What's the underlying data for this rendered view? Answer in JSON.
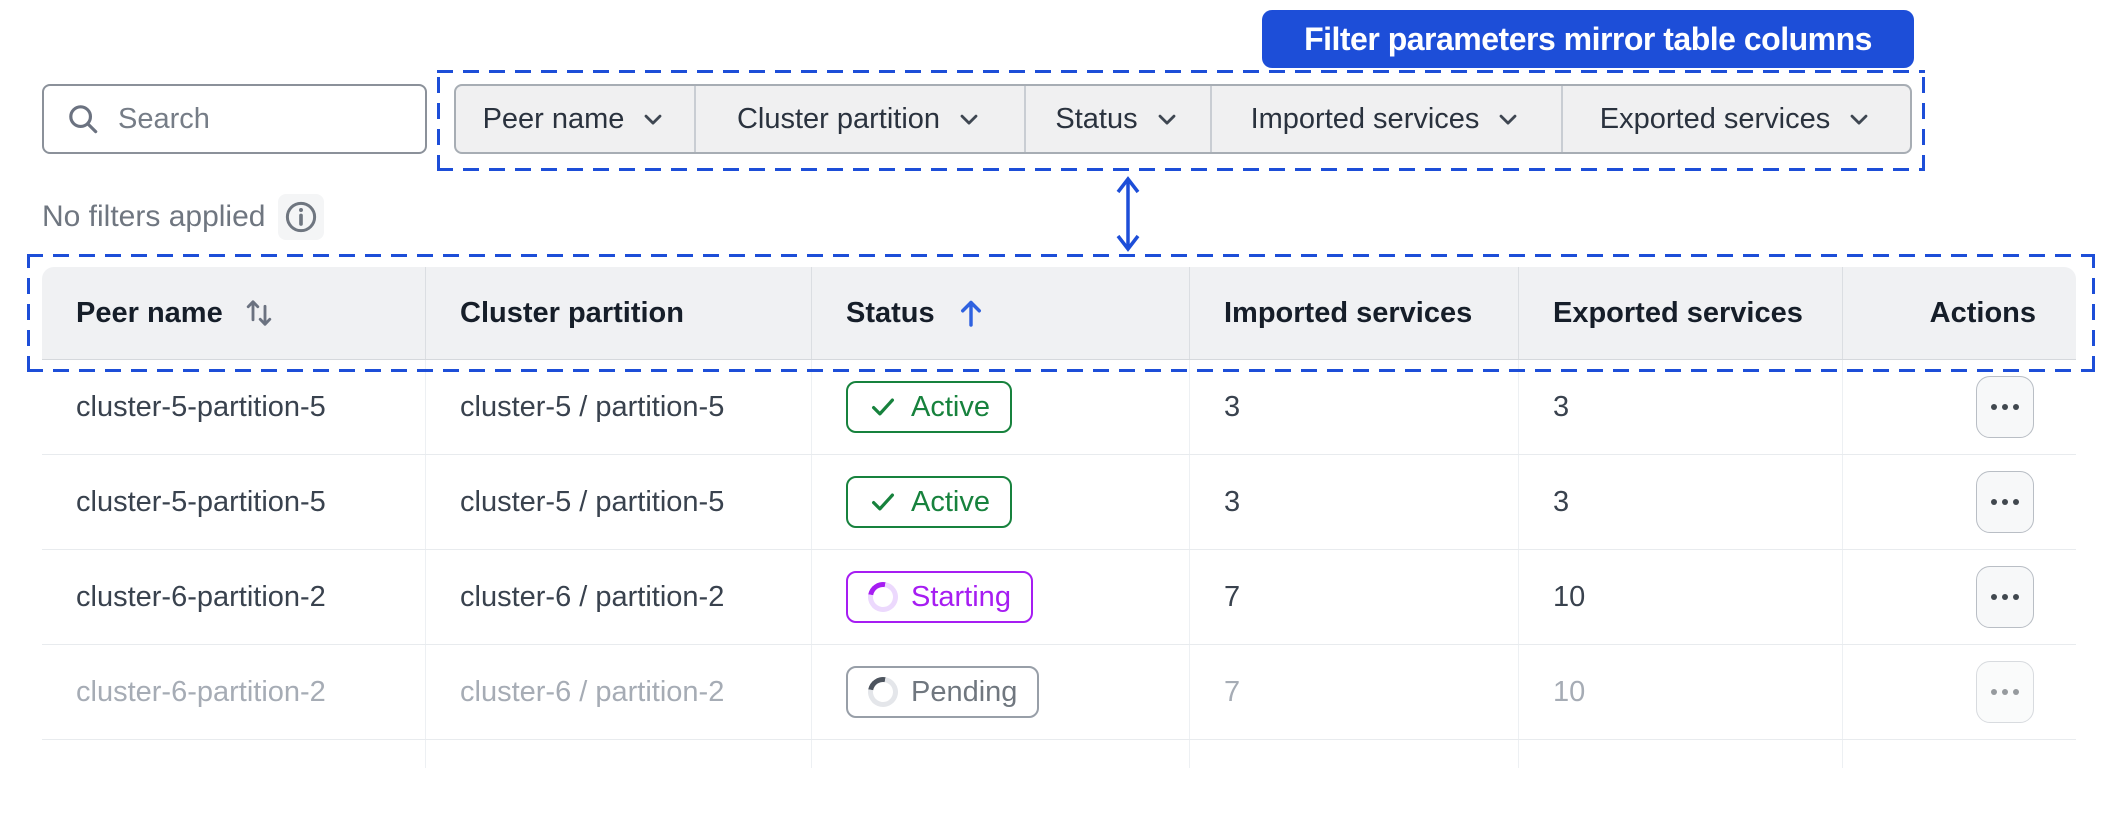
{
  "banner": {
    "text": "Filter parameters mirror table columns",
    "bg_color": "#1d4ed8",
    "text_color": "#ffffff"
  },
  "toolbar": {
    "search_placeholder": "Search",
    "filters": [
      {
        "label": "Peer name"
      },
      {
        "label": "Cluster partition"
      },
      {
        "label": "Status"
      },
      {
        "label": "Imported services"
      },
      {
        "label": "Exported services"
      }
    ],
    "no_filters_text": "No filters applied"
  },
  "table": {
    "columns": [
      {
        "label": "Peer name",
        "sort": "sortable"
      },
      {
        "label": "Cluster partition",
        "sort": "none"
      },
      {
        "label": "Status",
        "sort": "ascending"
      },
      {
        "label": "Imported services",
        "sort": "none"
      },
      {
        "label": "Exported services",
        "sort": "none"
      },
      {
        "label": "Actions",
        "sort": "none"
      }
    ],
    "rows": [
      {
        "peer_name": "cluster-5-partition-5",
        "cluster_partition": "cluster-5 / partition-5",
        "status": "Active",
        "imported_services": "3",
        "exported_services": "3",
        "dimmed": false
      },
      {
        "peer_name": "cluster-5-partition-5",
        "cluster_partition": "cluster-5 / partition-5",
        "status": "Active",
        "imported_services": "3",
        "exported_services": "3",
        "dimmed": false
      },
      {
        "peer_name": "cluster-6-partition-2",
        "cluster_partition": "cluster-6 / partition-2",
        "status": "Starting",
        "imported_services": "7",
        "exported_services": "10",
        "dimmed": false
      },
      {
        "peer_name": "cluster-6-partition-2",
        "cluster_partition": "cluster-6 / partition-2",
        "status": "Pending",
        "imported_services": "7",
        "exported_services": "10",
        "dimmed": true
      }
    ]
  },
  "icons": {
    "search": "magnifier",
    "info": "info-circle",
    "filter_chevron": "chevron-down",
    "peer_name_sort": "arrows-up-down",
    "status_sort": "arrow-up",
    "row_actions": "ellipsis"
  },
  "colors": {
    "accent": "#1d4ed8",
    "status_active": "#17823d",
    "status_starting": "#a61df2",
    "status_pending": "#70777f"
  }
}
